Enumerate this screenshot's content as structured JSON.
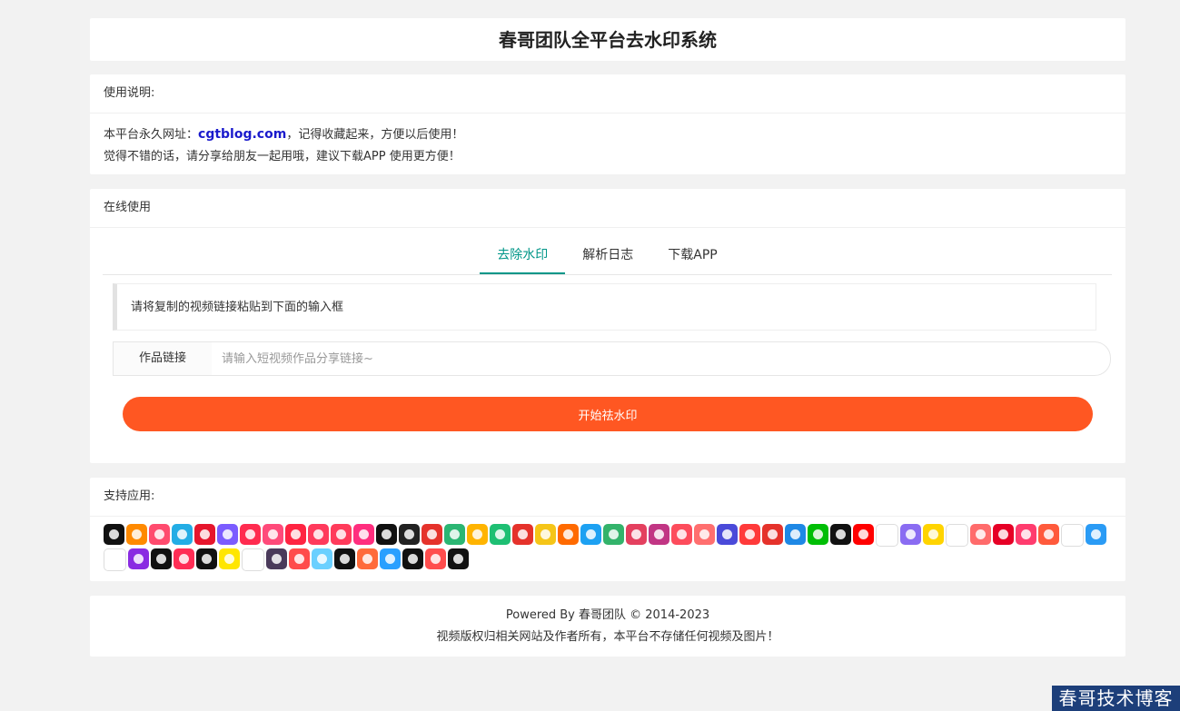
{
  "page": {
    "title": "春哥团队全平台去水印系统"
  },
  "info": {
    "header": "使用说明:",
    "line1_prefix": "本平台永久网址：",
    "line1_link": "cgtblog.com",
    "line1_suffix": "，记得收藏起来，方便以后使用！",
    "line2": "觉得不错的话，请分享给朋友一起用哦，建议下载APP 使用更方便！"
  },
  "online": {
    "header": "在线使用",
    "tabs": [
      {
        "label": "去除水印",
        "active": true
      },
      {
        "label": "解析日志",
        "active": false
      },
      {
        "label": "下载APP",
        "active": false
      }
    ],
    "notice": "请将复制的视频链接粘贴到下面的输入框",
    "field_label": "作品链接",
    "field_placeholder": "请输入短视频作品分享链接~",
    "field_value": "",
    "button_label": "开始祛水印"
  },
  "apps": {
    "header": "支持应用:",
    "icons": [
      {
        "name": "douyin-icon",
        "color": "#111111"
      },
      {
        "name": "kuaishou-icon",
        "color": "#ff8a00"
      },
      {
        "name": "pipixia-icon",
        "color": "#ff4b6e"
      },
      {
        "name": "bilibili-icon",
        "color": "#23ade5"
      },
      {
        "name": "weibo-icon",
        "color": "#e6162d"
      },
      {
        "name": "huoshan-icon",
        "color": "#7b5cff"
      },
      {
        "name": "xigua-icon",
        "color": "#ff2b4f"
      },
      {
        "name": "meipai-icon",
        "color": "#ff4a7a"
      },
      {
        "name": "xiaohongshu-icon",
        "color": "#ff2442"
      },
      {
        "name": "weishi-icon",
        "color": "#ff3a5c"
      },
      {
        "name": "haokan-icon",
        "color": "#ff3b5b"
      },
      {
        "name": "youku-icon",
        "color": "#ff2e7e"
      },
      {
        "name": "capcut-icon",
        "color": "#111111"
      },
      {
        "name": "xiaoying-icon",
        "color": "#222222"
      },
      {
        "name": "toutiao-icon",
        "color": "#e5322b"
      },
      {
        "name": "lvzhou-icon",
        "color": "#2bb673"
      },
      {
        "name": "kuaishou-jisu-icon",
        "color": "#ffb400"
      },
      {
        "name": "qutoutiao-icon",
        "color": "#1ebf73"
      },
      {
        "name": "kuaibao-icon",
        "color": "#e5322b"
      },
      {
        "name": "qq-video-icon",
        "color": "#f5c518"
      },
      {
        "name": "play-icon",
        "color": "#ff6a00"
      },
      {
        "name": "twitter-icon",
        "color": "#1da1f2"
      },
      {
        "name": "lvyou-icon",
        "color": "#33b36b"
      },
      {
        "name": "momo-icon",
        "color": "#e4405f"
      },
      {
        "name": "instagram-icon",
        "color": "#c13584"
      },
      {
        "name": "acfun-icon",
        "color": "#fd4c5c"
      },
      {
        "name": "avatar-app-icon",
        "color": "#ff6f6f"
      },
      {
        "name": "shua-icon",
        "color": "#4a4ad9"
      },
      {
        "name": "zuiyou-icon",
        "color": "#ff3a3a"
      },
      {
        "name": "yitiao-icon",
        "color": "#e5322b"
      },
      {
        "name": "tencent-video-icon",
        "color": "#1e88e5"
      },
      {
        "name": "iqiyi-icon",
        "color": "#00be06"
      },
      {
        "name": "tiktok-icon",
        "color": "#111111"
      },
      {
        "name": "youtube-icon",
        "color": "#ff0000"
      },
      {
        "name": "cartoon-icon",
        "color": "#ffffff"
      },
      {
        "name": "qq-icon",
        "color": "#8a6cf2"
      },
      {
        "name": "weishi-yellow-icon",
        "color": "#ffd400"
      },
      {
        "name": "eye-icon",
        "color": "#ffffff"
      },
      {
        "name": "face-icon",
        "color": "#ff6b6b"
      },
      {
        "name": "netease-icon",
        "color": "#e60026"
      },
      {
        "name": "shipin-icon",
        "color": "#ff3c6e"
      },
      {
        "name": "kid-icon",
        "color": "#ff5a3c"
      },
      {
        "name": "bird-icon",
        "color": "#ffffff"
      },
      {
        "name": "penguin-icon",
        "color": "#2a9bf5"
      },
      {
        "name": "uc-icon",
        "color": "#ffffff"
      },
      {
        "name": "play-purple-icon",
        "color": "#8a2be2"
      },
      {
        "name": "stripes-icon",
        "color": "#111111"
      },
      {
        "name": "new-icon",
        "color": "#ff2d55"
      },
      {
        "name": "changku-icon",
        "color": "#111111"
      },
      {
        "name": "yellow-play-icon",
        "color": "#ffe600"
      },
      {
        "name": "b-letter-icon",
        "color": "#ffffff"
      },
      {
        "name": "k-letter-icon",
        "color": "#4a3a5a"
      },
      {
        "name": "q-search-icon",
        "color": "#ff4b4b"
      },
      {
        "name": "orb-icon",
        "color": "#6ad0ff"
      },
      {
        "name": "mouth-icon",
        "color": "#111111"
      },
      {
        "name": "monkey-icon",
        "color": "#ff6b3a"
      },
      {
        "name": "heart-icon",
        "color": "#2aa0ff"
      },
      {
        "name": "bianfeng-icon",
        "color": "#111111"
      },
      {
        "name": "chinese-char-icon",
        "color": "#ff4d4d"
      },
      {
        "name": "ring-icon",
        "color": "#111111"
      }
    ]
  },
  "footer": {
    "line1": "Powered By 春哥团队 © 2014-2023",
    "line2": "视频版权归相关网站及作者所有，本平台不存储任何视频及图片！"
  },
  "watermark": "春哥技术博客"
}
